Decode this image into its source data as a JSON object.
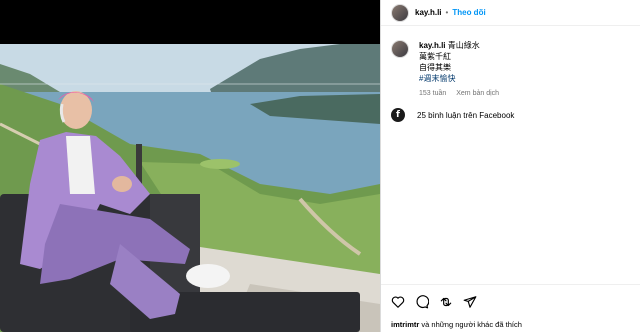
{
  "post": {
    "username": "kay.h.li",
    "follow_label": "Theo dõi",
    "separator": "•",
    "caption_lines": [
      "青山綠水",
      "萬紫千紅",
      "自得其樂"
    ],
    "hashtag": "#週末愉快",
    "time": "153 tuần",
    "translate_label": "Xem bản dịch",
    "facebook_comments": "25 bình luận trên Facebook",
    "liked_by_user": "imtrimtr",
    "liked_by_suffix": " và những người khác đã thích"
  },
  "icons": {
    "like": "heart-icon",
    "comment": "comment-icon",
    "share": "share-icon",
    "send": "send-icon",
    "facebook": "facebook-icon"
  },
  "colors": {
    "follow": "#0095f6",
    "hashtag": "#00376b",
    "meta": "#737373"
  }
}
